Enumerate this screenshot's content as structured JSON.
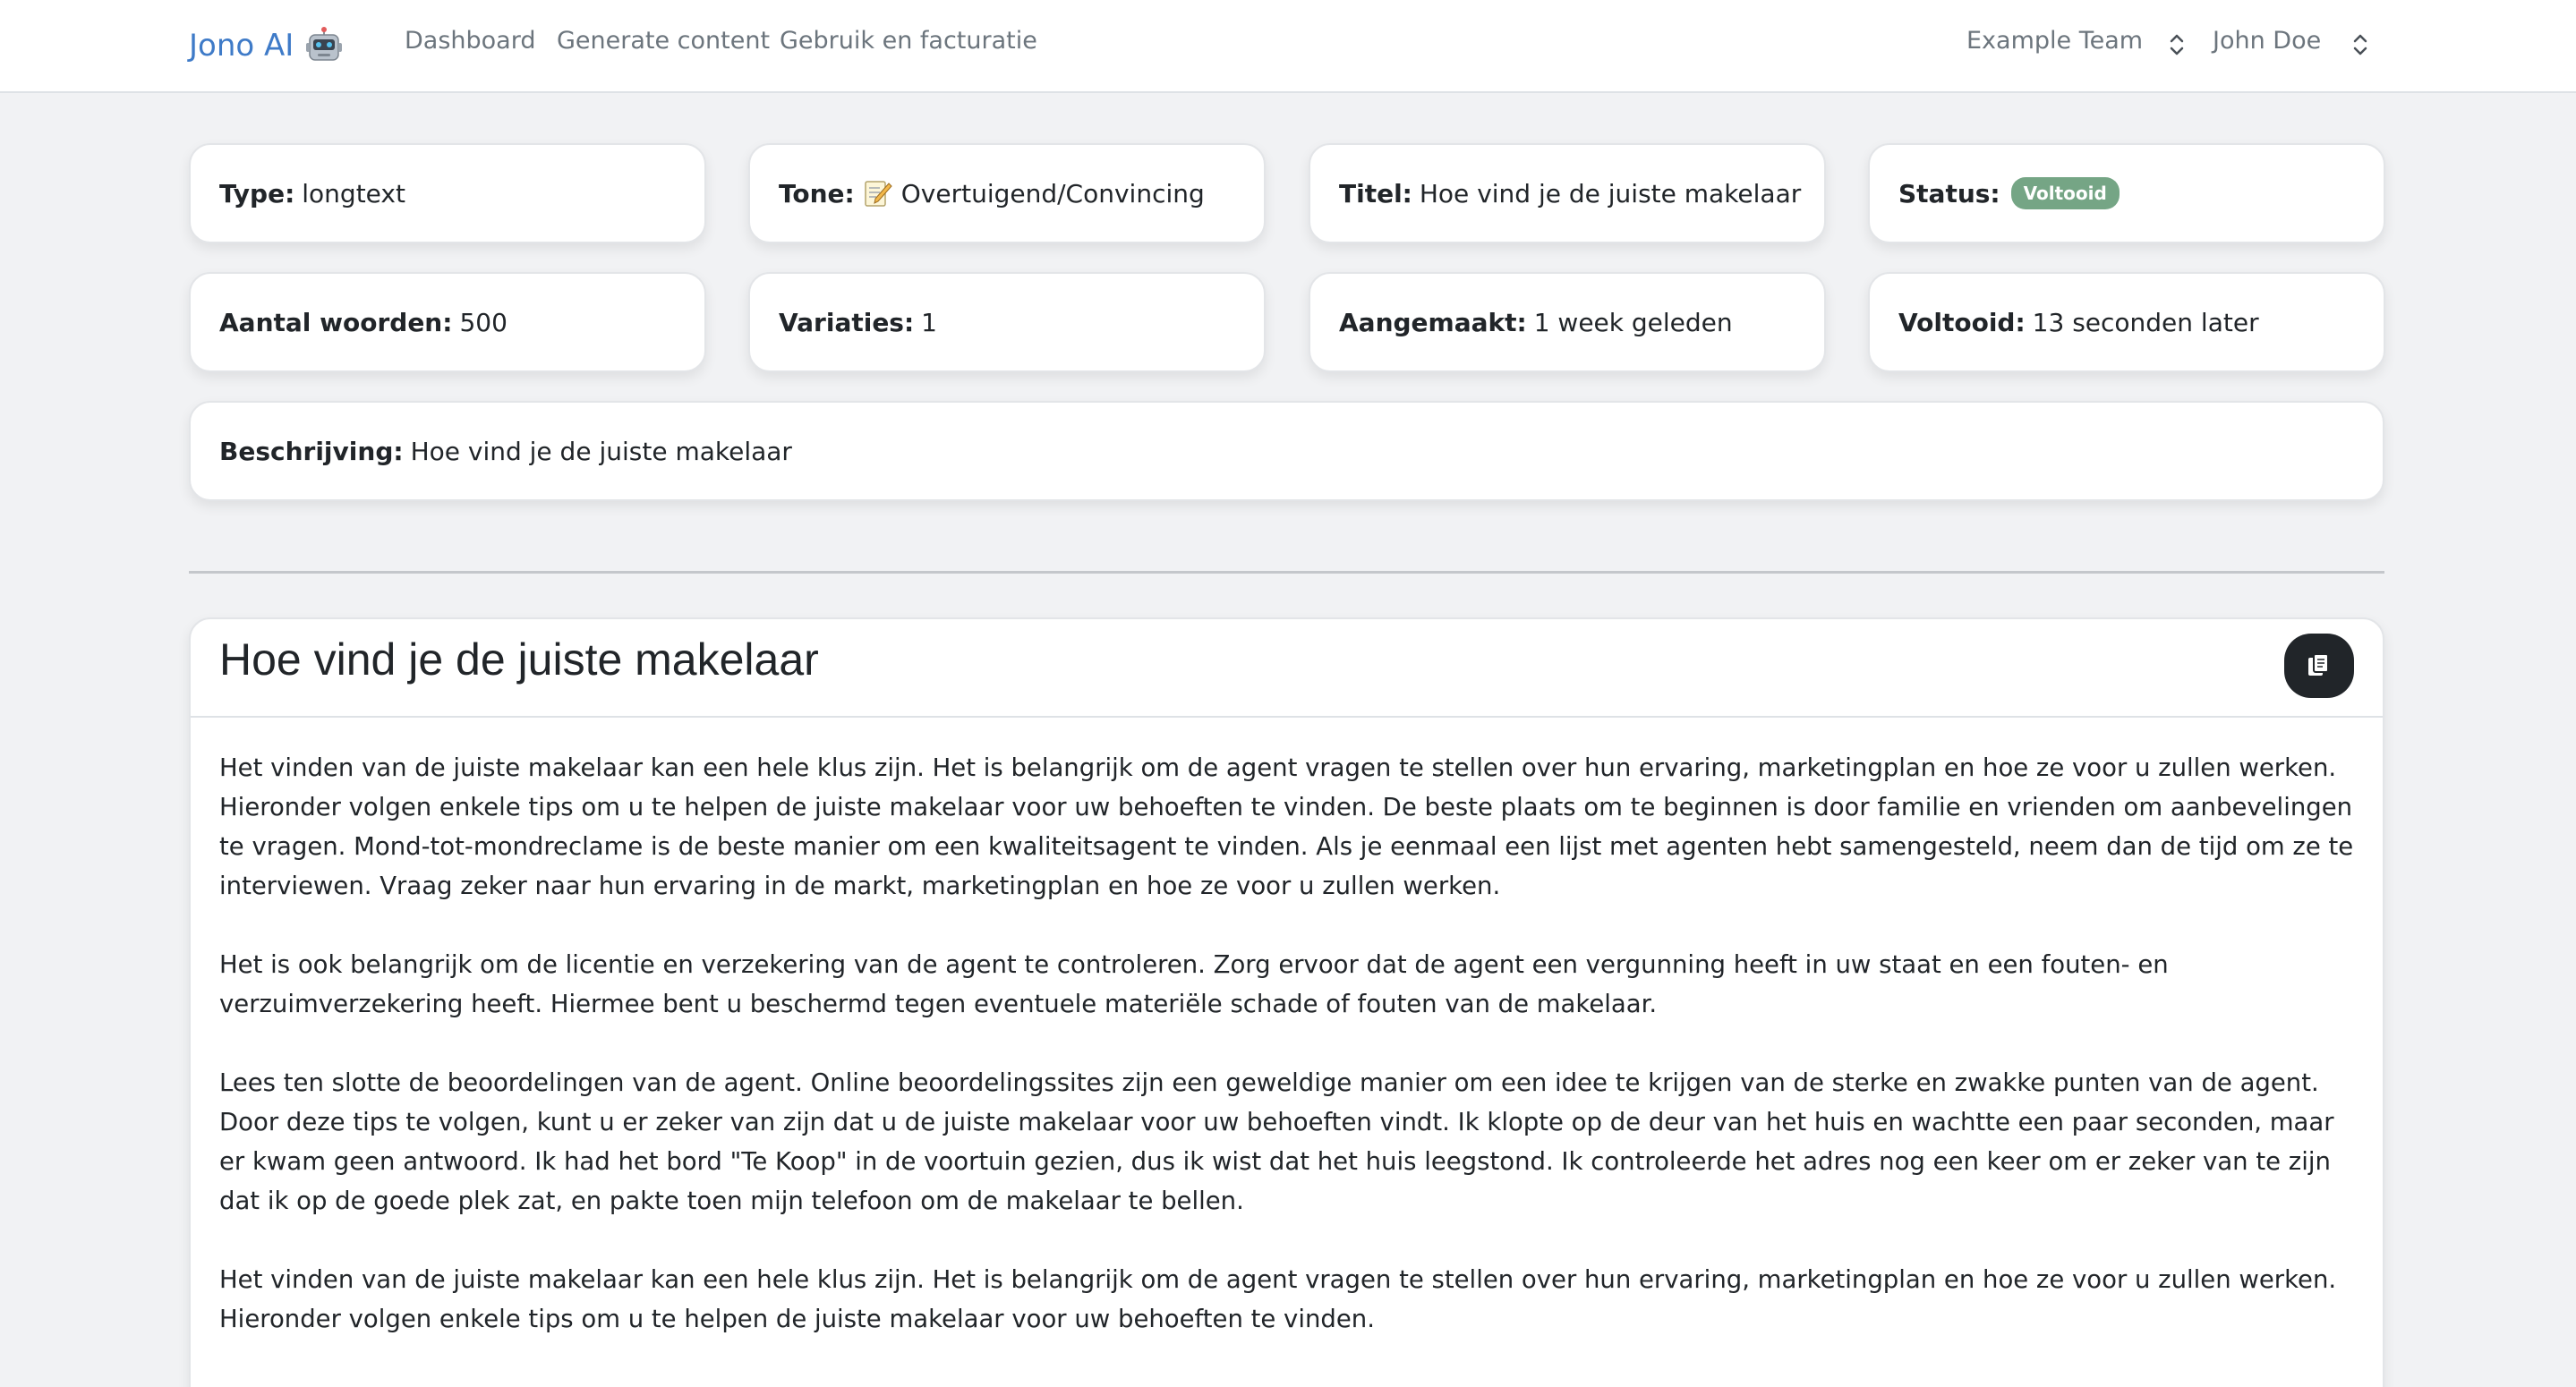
{
  "nav": {
    "brand": "Jono AI",
    "links": [
      "Dashboard",
      "Generate content",
      "Gebruik en facturatie"
    ],
    "team": "Example Team",
    "user": "John Doe"
  },
  "info": {
    "type_label": "Type:",
    "type_value": "longtext",
    "tone_label": "Tone:",
    "tone_value": "Overtuigend/Convincing",
    "title_label": "Titel:",
    "title_value": "Hoe vind je de juiste makelaar",
    "status_label": "Status:",
    "status_value": "Voltooid",
    "words_label": "Aantal woorden:",
    "words_value": "500",
    "variations_label": "Variaties:",
    "variations_value": "1",
    "created_label": "Aangemaakt:",
    "created_value": "1 week geleden",
    "completed_label": "Voltooid:",
    "completed_value": "13 seconden later",
    "description_label": "Beschrijving:",
    "description_value": "Hoe vind je de juiste makelaar"
  },
  "content": {
    "title": "Hoe vind je de juiste makelaar",
    "paragraphs": [
      "Het vinden van de juiste makelaar kan een hele klus zijn. Het is belangrijk om de agent vragen te stellen over hun ervaring, marketingplan en hoe ze voor u zullen werken. Hieronder volgen enkele tips om u te helpen de juiste makelaar voor uw behoeften te vinden. De beste plaats om te beginnen is door familie en vrienden om aanbevelingen te vragen. Mond-tot-mondreclame is de beste manier om een kwaliteitsagent te vinden. Als je eenmaal een lijst met agenten hebt samengesteld, neem dan de tijd om ze te interviewen. Vraag zeker naar hun ervaring in de markt, marketingplan en hoe ze voor u zullen werken.",
      "Het is ook belangrijk om de licentie en verzekering van de agent te controleren. Zorg ervoor dat de agent een vergunning heeft in uw staat en een fouten- en verzuimverzekering heeft. Hiermee bent u beschermd tegen eventuele materiële schade of fouten van de makelaar.",
      "Lees ten slotte de beoordelingen van de agent. Online beoordelingssites zijn een geweldige manier om een idee te krijgen van de sterke en zwakke punten van de agent. Door deze tips te volgen, kunt u er zeker van zijn dat u de juiste makelaar voor uw behoeften vindt. Ik klopte op de deur van het huis en wachtte een paar seconden, maar er kwam geen antwoord. Ik had het bord \"Te Koop\" in de voortuin gezien, dus ik wist dat het huis leegstond. Ik controleerde het adres nog een keer om er zeker van te zijn dat ik op de goede plek zat, en pakte toen mijn telefoon om de makelaar te bellen.",
      "Het vinden van de juiste makelaar kan een hele klus zijn. Het is belangrijk om de agent vragen te stellen over hun ervaring, marketingplan en hoe ze voor u zullen werken. Hieronder volgen enkele tips om u te helpen de juiste makelaar voor uw behoeften te vinden."
    ]
  },
  "colors": {
    "brand": "#3f7bc8",
    "badge": "#75a585",
    "copy_button": "#212529"
  },
  "icons": {
    "brand": "robot-icon",
    "tone": "memo-icon",
    "selector": "chevron-updown-icon",
    "copy": "copy-icon"
  }
}
